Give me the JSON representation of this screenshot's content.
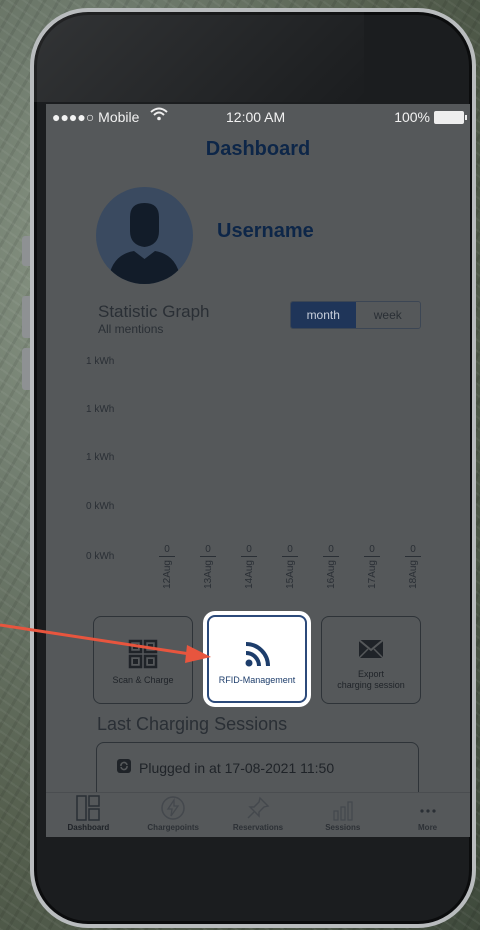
{
  "status_bar": {
    "carrier": "●●●●○ Mobile",
    "time": "12:00 AM",
    "battery": "100%"
  },
  "header": {
    "title": "Dashboard"
  },
  "profile": {
    "username": "Username"
  },
  "graph": {
    "title": "Statistic Graph",
    "subtitle": "All mentions",
    "toggle": {
      "month": "month",
      "week": "week",
      "selected": "month"
    }
  },
  "chart_data": {
    "type": "bar",
    "categories": [
      "12Aug",
      "13Aug",
      "14Aug",
      "15Aug",
      "16Aug",
      "17Aug",
      "18Aug"
    ],
    "values": [
      0,
      0,
      0,
      0,
      0,
      0,
      0
    ],
    "y_tick_labels": [
      "1 kWh",
      "1 kWh",
      "1 kWh",
      "0 kWh",
      "0 kWh"
    ],
    "value_labels": [
      "0",
      "0",
      "0",
      "0",
      "0",
      "0",
      "0"
    ]
  },
  "actions": {
    "scan": "Scan & Charge",
    "rfid": "RFID-Management",
    "export_1": "Export",
    "export_2": "charging session"
  },
  "sessions": {
    "title": "Last Charging Sessions",
    "item": "Plugged in at  17-08-2021 11:50"
  },
  "tabs": {
    "dashboard": "Dashboard",
    "chargepoints": "Chargepoints",
    "reservations": "Reservations",
    "sessions": "Sessions",
    "more": "More"
  },
  "colors": {
    "accent": "#1d3d6b",
    "arrow": "#e8553e",
    "highlight": "#ffffff"
  }
}
